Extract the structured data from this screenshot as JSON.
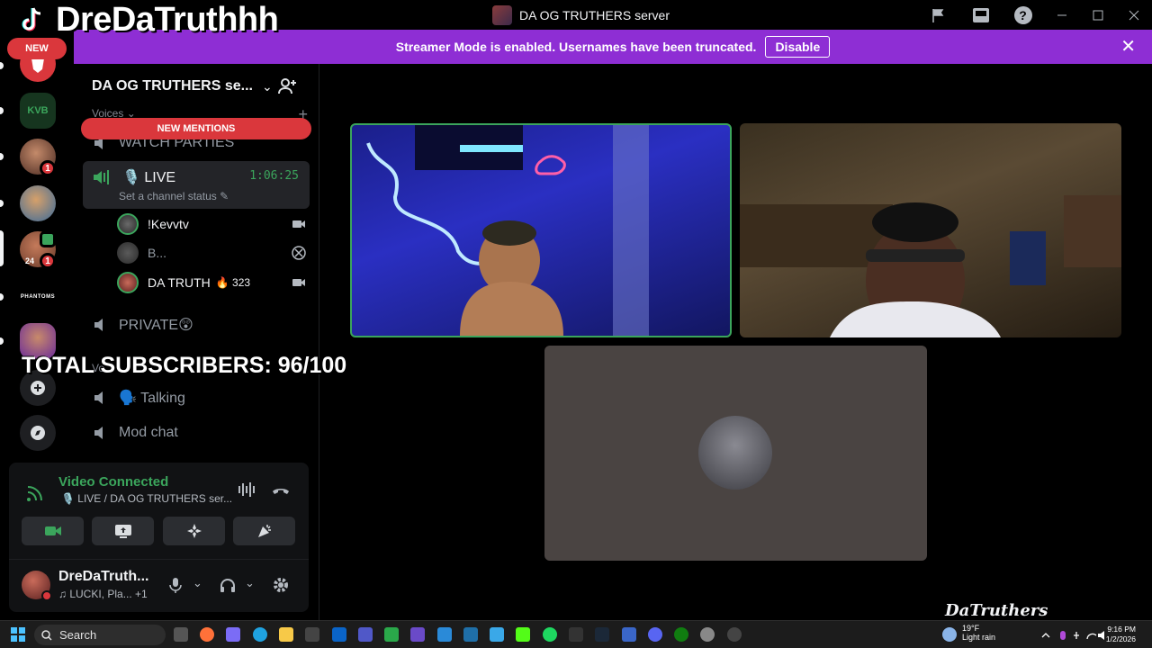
{
  "overlay": {
    "brand_name": "DreDaTruthhh",
    "new_badge": "NEW",
    "subscribers_text": "TOTAL SUBSCRIBERS: 96/100",
    "watermark": "DaTruthers"
  },
  "window": {
    "title": "DA OG TRUTHERS server"
  },
  "banner": {
    "text": "Streamer Mode is enabled. Usernames have been truncated.",
    "button": "Disable"
  },
  "rail": {
    "servers": [
      {
        "name": "server-1",
        "badge": ""
      },
      {
        "name": "KVB",
        "label": "KVB",
        "badge": ""
      },
      {
        "name": "server-3",
        "badge": "1"
      },
      {
        "name": "server-4",
        "badge": ""
      },
      {
        "name": "server-5",
        "badge": "1",
        "sub_badge": "24"
      },
      {
        "name": "PHANTOMS",
        "label": "PHANTOMS",
        "badge": ""
      },
      {
        "name": "server-7",
        "badge": ""
      }
    ]
  },
  "sidebar": {
    "server_name": "DA OG TRUTHERS se...",
    "category": "Voices",
    "new_mentions": "NEW MENTIONS",
    "channels": [
      {
        "name": "WATCH PARTIES"
      },
      {
        "name": "🎙️ LIVE",
        "time": "1:06:25",
        "status": "Set a channel status"
      },
      {
        "name": "PRIVATE😲"
      },
      {
        "name": "🗣️ Talking"
      },
      {
        "name": "Mod chat"
      }
    ],
    "voice_users": [
      {
        "name": "!Kevvtv",
        "status_icon": "camera-icon"
      },
      {
        "name": "B...",
        "status_icon": "xbox-icon"
      },
      {
        "name": "DA TRUTH",
        "extra": "🔥 323",
        "status_icon": "camera-icon"
      }
    ],
    "hidden_label": "Vo"
  },
  "voice_panel": {
    "title": "Video Connected",
    "subtitle": "🎙️ LIVE / DA OG TRUTHERS ser...",
    "user_name": "DreDaTruth...",
    "user_status": "♫ LUCKI, Pla... +1"
  },
  "taskbar": {
    "search": "Search",
    "temperature": "19°F",
    "weather": "Light rain",
    "time": "9:16 PM",
    "date": "1/2/2026"
  },
  "colors": {
    "banner": "#8e2ed4",
    "speaking": "#3ba55c",
    "danger": "#da373c"
  }
}
